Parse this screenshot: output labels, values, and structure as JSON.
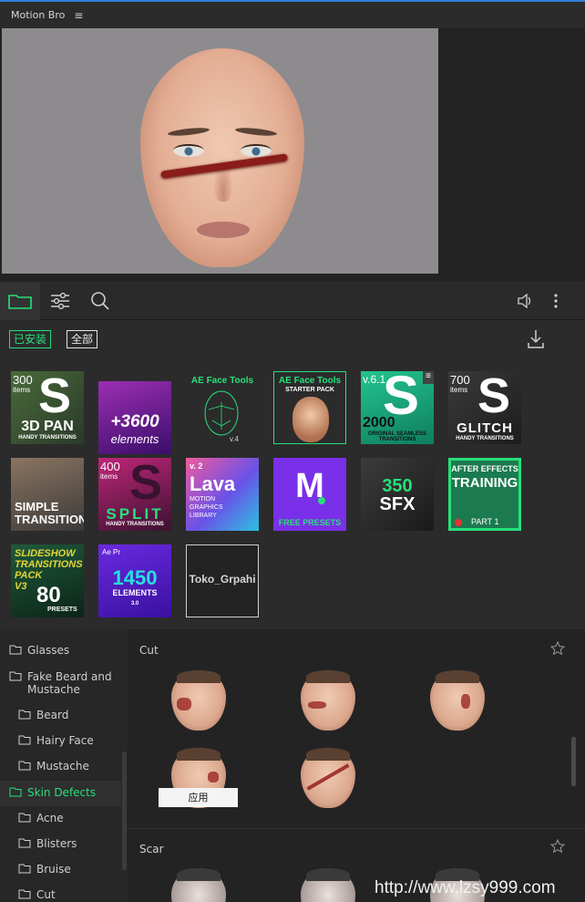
{
  "window": {
    "title": "Motion Bro",
    "menu_glyph": "≡"
  },
  "toolbar": {
    "tabs": [
      {
        "name": "folder-icon",
        "active": true
      },
      {
        "name": "sliders-icon",
        "active": false
      },
      {
        "name": "search-icon",
        "active": false
      }
    ],
    "right": [
      "speaker-icon",
      "more-vertical-icon"
    ]
  },
  "filters": {
    "installed_label": "已安装",
    "all_label": "全部",
    "download_icon": "download-icon"
  },
  "packs": [
    {
      "top": "300",
      "sub": "items",
      "big": "S",
      "title": "3D PAN",
      "footer": "HANDY TRANSITIONS"
    },
    {
      "title": "+3600",
      "footer": "elements"
    },
    {
      "title": "AE Face Tools",
      "footer": "v.4"
    },
    {
      "title": "AE Face Tools",
      "sub": "STARTER PACK"
    },
    {
      "top": "v.6.1",
      "big": "S",
      "title": "2000",
      "footer": "ORIGINAL SEAMLESS TRANSITIONS",
      "menu": "≡"
    },
    {
      "top": "700",
      "sub": "items",
      "big": "S",
      "title": "GLITCH",
      "footer": "HANDY TRANSITIONS"
    },
    {
      "title": "SIMPLE",
      "footer": "TRANSITIONS"
    },
    {
      "top": "400",
      "sub": "items",
      "big": "S",
      "title": "SPLIT",
      "footer": "HANDY TRANSITIONS"
    },
    {
      "top": "v. 2",
      "title": "Lava",
      "sub": "MOTION",
      "sub2": "GRAPHICS",
      "footer": "LIBRARY"
    },
    {
      "title": "M",
      "footer": "FREE PRESETS"
    },
    {
      "title": "350",
      "footer": "SFX"
    },
    {
      "top": "AFTER EFFECTS",
      "title": "TRAINING",
      "footer": "PART 1"
    },
    {
      "top": "SLIDESHOW",
      "sub": "TRANSITIONS",
      "sub2": "PACK",
      "small": "V3",
      "title": "80",
      "footer": "PRESETS"
    },
    {
      "top": "Ae Pr",
      "title": "1450",
      "sub": "ELEMENTS",
      "footer": "3.0"
    },
    {
      "title": "Toko_Grpahi"
    }
  ],
  "sidebar": {
    "items": [
      {
        "label": "Glasses",
        "level": 0
      },
      {
        "label": "Fake Beard and Mustache",
        "level": 0
      },
      {
        "label": "Beard",
        "level": 1
      },
      {
        "label": "Hairy Face",
        "level": 1
      },
      {
        "label": "Mustache",
        "level": 1
      },
      {
        "label": "Skin Defects",
        "level": 0,
        "active": true
      },
      {
        "label": "Acne",
        "level": 1
      },
      {
        "label": "Blisters",
        "level": 1
      },
      {
        "label": "Bruise",
        "level": 1
      },
      {
        "label": "Cut",
        "level": 1
      }
    ]
  },
  "content": {
    "sections": [
      {
        "title": "Cut"
      },
      {
        "title": "Scar"
      }
    ],
    "apply_label": "应用"
  },
  "watermark": "http://www.lzsy999.com",
  "colors": {
    "accent": "#27e07a",
    "titlebar_border": "#2f7fd6"
  }
}
